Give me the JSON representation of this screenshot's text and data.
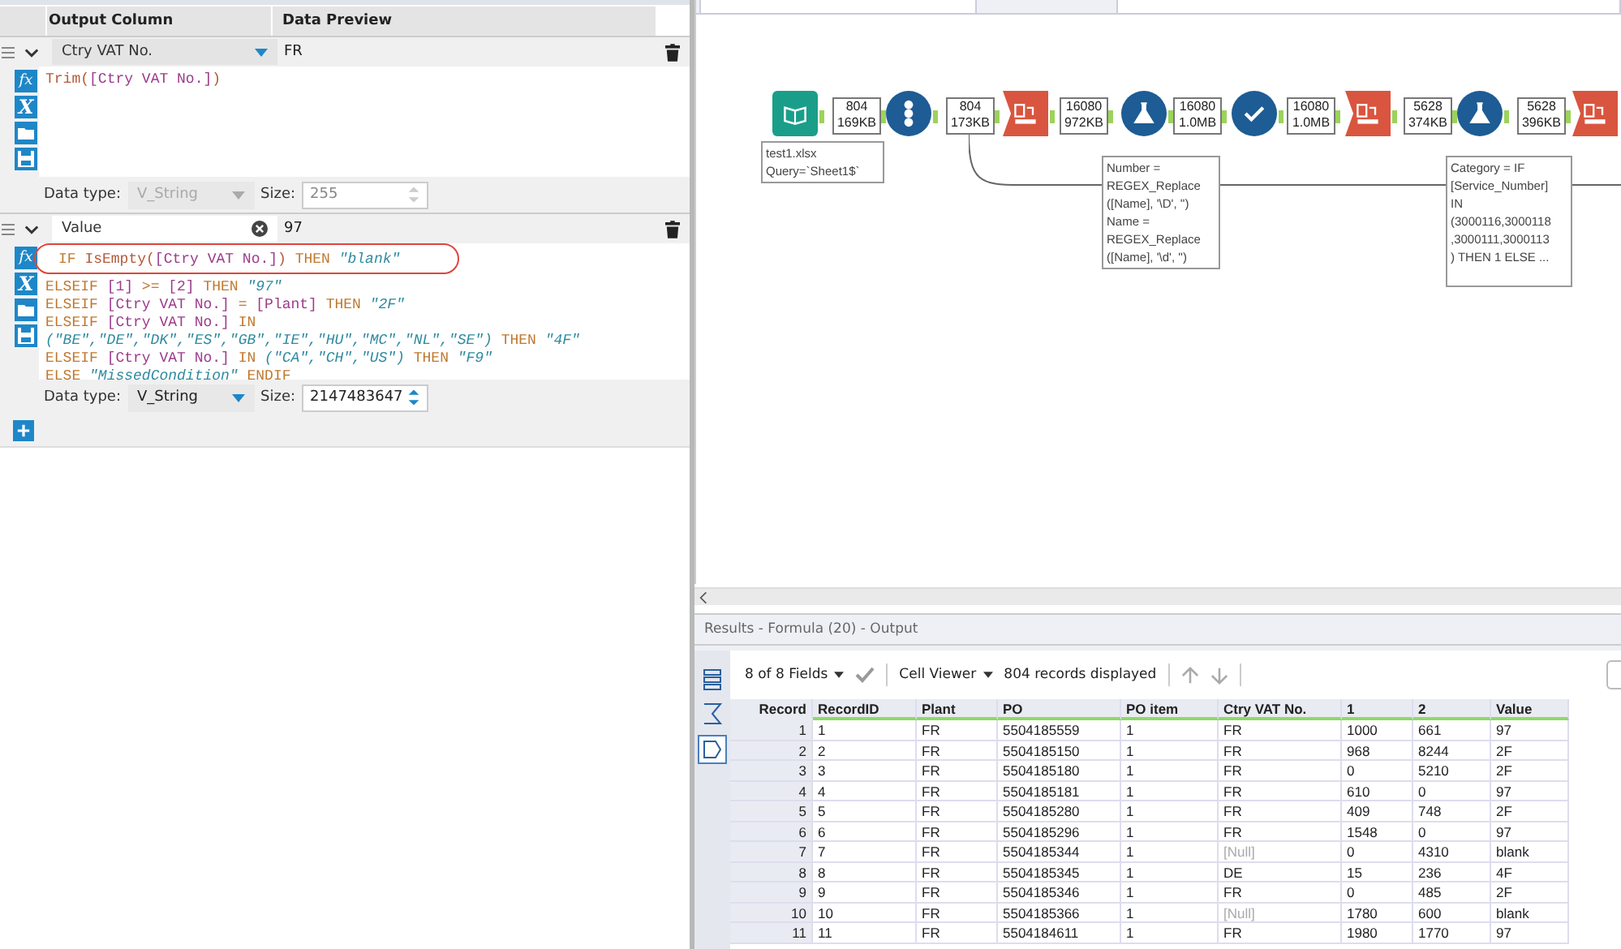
{
  "formula_panel": {
    "columns": [
      "Output Column",
      "Data Preview"
    ],
    "expressions": [
      {
        "kind": "existing",
        "tool_icons": [
          "fx",
          "X"
        ],
        "data_type_label": "Data type:",
        "size_label": "Size:",
        "output_column": "Ctry VAT No.",
        "preview": "FR",
        "expanded": true,
        "data_type": "V_String",
        "data_type_enabled": false,
        "size": "255",
        "code": [
          [
            {
              "kind": "fn",
              "t": "Trim("
            },
            {
              "kind": "field",
              "t": "[Ctry VAT No.]"
            },
            {
              "kind": "fn",
              "t": ")"
            }
          ]
        ]
      },
      {
        "kind": "new",
        "tool_icons": [
          "fx",
          "X"
        ],
        "data_type_label": "Data type:",
        "size_label": "Size:",
        "output_column": "Value",
        "preview": "97",
        "expanded": true,
        "data_type": "V_String",
        "data_type_enabled": true,
        "size": "2147483647",
        "code": [
          [
            {
              "kind": "kw",
              "t": "IF "
            },
            {
              "kind": "fn",
              "t": "IsEmpty("
            },
            {
              "kind": "field",
              "t": "[Ctry VAT No.]"
            },
            {
              "kind": "fn",
              "t": ")"
            },
            {
              "kind": "kw",
              "t": " THEN "
            },
            {
              "kind": "str",
              "t": "\"blank\""
            }
          ],
          [
            {
              "kind": "kw",
              "t": "ELSEIF "
            },
            {
              "kind": "field",
              "t": "[1]"
            },
            {
              "kind": "kw",
              "t": " >= "
            },
            {
              "kind": "field",
              "t": "[2]"
            },
            {
              "kind": "kw",
              "t": " THEN "
            },
            {
              "kind": "str",
              "t": "\"97\""
            }
          ],
          [
            {
              "kind": "kw",
              "t": "ELSEIF "
            },
            {
              "kind": "field",
              "t": "[Ctry VAT No.]"
            },
            {
              "kind": "kw",
              "t": " = "
            },
            {
              "kind": "field",
              "t": "[Plant]"
            },
            {
              "kind": "kw",
              "t": " THEN "
            },
            {
              "kind": "str",
              "t": "\"2F\""
            }
          ],
          [
            {
              "kind": "kw",
              "t": "ELSEIF "
            },
            {
              "kind": "field",
              "t": "[Ctry VAT No.]"
            },
            {
              "kind": "kw",
              "t": " IN"
            }
          ],
          [
            {
              "kind": "str",
              "t": "(\"BE\",\"DE\",\"DK\",\"ES\",\"GB\",\"IE\",\"HU\",\"MC\",\"NL\",\"SE\")"
            },
            {
              "kind": "kw",
              "t": " THEN "
            },
            {
              "kind": "str",
              "t": "\"4F\""
            }
          ],
          [
            {
              "kind": "kw",
              "t": "ELSEIF "
            },
            {
              "kind": "field",
              "t": "[Ctry VAT No.]"
            },
            {
              "kind": "kw",
              "t": " IN "
            },
            {
              "kind": "str",
              "t": "(\"CA\",\"CH\",\"US\")"
            },
            {
              "kind": "kw",
              "t": " THEN "
            },
            {
              "kind": "str",
              "t": "\"F9\""
            }
          ],
          [
            {
              "kind": "kw",
              "t": "ELSE "
            },
            {
              "kind": "str",
              "t": "\"MissedCondition\""
            },
            {
              "kind": "kw",
              "t": " ENDIF"
            }
          ]
        ]
      }
    ]
  },
  "workflow": {
    "tools": [
      {
        "kind": "input",
        "annotation": [
          "test1.xlsx",
          "Query=`Sheet1$`"
        ]
      },
      {
        "kind": "recordid"
      },
      {
        "kind": "transpose"
      },
      {
        "kind": "formula",
        "annotation": [
          "Number =",
          "REGEX_Replace",
          "([Name], '\\D', '')",
          "Name =",
          "REGEX_Replace",
          "([Name], '\\d', '')"
        ]
      },
      {
        "kind": "select"
      },
      {
        "kind": "crosstab"
      },
      {
        "kind": "formula",
        "annotation": [
          "Category = IF",
          "[Service_Number]",
          "IN",
          "(3000116,3000118",
          ",3000111,3000113",
          ") THEN 1 ELSE ..."
        ]
      },
      {
        "kind": "crosstab"
      }
    ],
    "badges": [
      {
        "records": "804",
        "size": "169KB"
      },
      {
        "records": "804",
        "size": "173KB"
      },
      {
        "records": "16080",
        "size": "972KB"
      },
      {
        "records": "16080",
        "size": "1.0MB"
      },
      {
        "records": "16080",
        "size": "1.0MB"
      },
      {
        "records": "5628",
        "size": "374KB"
      },
      {
        "records": "5628",
        "size": "396KB"
      }
    ]
  },
  "results": {
    "title": "Results - Formula (20) - Output",
    "fields": "8 of 8 Fields",
    "viewer": "Cell Viewer",
    "records": "804 records displayed",
    "columns": [
      "Record",
      "RecordID",
      "Plant",
      "PO",
      "PO item",
      "Ctry VAT No.",
      "1",
      "2",
      "Value"
    ],
    "rows": [
      {
        "cells": [
          "1",
          "1",
          "FR",
          "5504185559",
          "1",
          "FR",
          "1000",
          "661",
          "97"
        ],
        "vat_null": false
      },
      {
        "cells": [
          "2",
          "2",
          "FR",
          "5504185150",
          "1",
          "FR",
          "968",
          "8244",
          "2F"
        ],
        "vat_null": false
      },
      {
        "cells": [
          "3",
          "3",
          "FR",
          "5504185180",
          "1",
          "FR",
          "0",
          "5210",
          "2F"
        ],
        "vat_null": false
      },
      {
        "cells": [
          "4",
          "4",
          "FR",
          "5504185181",
          "1",
          "FR",
          "610",
          "0",
          "97"
        ],
        "vat_null": false
      },
      {
        "cells": [
          "5",
          "5",
          "FR",
          "5504185280",
          "1",
          "FR",
          "409",
          "748",
          "2F"
        ],
        "vat_null": false
      },
      {
        "cells": [
          "6",
          "6",
          "FR",
          "5504185296",
          "1",
          "FR",
          "1548",
          "0",
          "97"
        ],
        "vat_null": false
      },
      {
        "cells": [
          "7",
          "7",
          "FR",
          "5504185344",
          "1",
          "[Null]",
          "0",
          "4310",
          "blank"
        ],
        "vat_null": true
      },
      {
        "cells": [
          "8",
          "8",
          "FR",
          "5504185345",
          "1",
          "DE",
          "15",
          "236",
          "4F"
        ],
        "vat_null": false
      },
      {
        "cells": [
          "9",
          "9",
          "FR",
          "5504185346",
          "1",
          "FR",
          "0",
          "485",
          "2F"
        ],
        "vat_null": false
      },
      {
        "cells": [
          "10",
          "10",
          "FR",
          "5504185366",
          "1",
          "[Null]",
          "1780",
          "600",
          "blank"
        ],
        "vat_null": true
      },
      {
        "cells": [
          "11",
          "11",
          "FR",
          "5504184611",
          "1",
          "FR",
          "1980",
          "1770",
          "97"
        ],
        "vat_null": false
      }
    ]
  }
}
